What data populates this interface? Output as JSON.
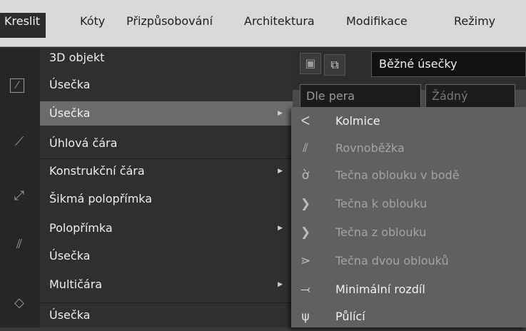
{
  "menubar": {
    "items": [
      "Kreslit",
      "Kóty",
      "Přizpůsobování",
      "Architektura",
      "Modifikace",
      "Režimy"
    ]
  },
  "toolbar": {
    "linetype_value": "Běžné úsečky",
    "pen_value": "Dle pera",
    "fill_value": "Žádný",
    "icons": [
      "3d-object-icon",
      "grid-icon",
      "hatch-icon",
      "snap-icon",
      "copy-icon",
      "layer-icon"
    ]
  },
  "main_menu": {
    "items": [
      {
        "label": "3D objekt",
        "icon": "3d-icon",
        "submenu": false
      },
      {
        "label": "Úsečka",
        "icon": "line-icon",
        "submenu": false
      },
      {
        "label": "Úsečka",
        "icon": "",
        "submenu": true,
        "highlighted": true
      },
      {
        "label": "Úhlová čára",
        "icon": "angle-line-icon",
        "submenu": false
      },
      {
        "label": "Konstrukční čára",
        "icon": "",
        "submenu": true
      },
      {
        "label": "Šikmá polopřímka",
        "icon": "ray-icon",
        "submenu": false
      },
      {
        "label": "Polopřímka",
        "icon": "",
        "submenu": true
      },
      {
        "label": "Úsečka",
        "icon": "parallel-icon",
        "submenu": false
      },
      {
        "label": "Multičára",
        "icon": "",
        "submenu": true
      },
      {
        "label": "Úsečka",
        "icon": "polyline-icon",
        "submenu": false
      }
    ]
  },
  "submenu": {
    "items": [
      {
        "label": "Kolmice",
        "icon": "perpendicular-icon",
        "enabled": true
      },
      {
        "label": "Rovnoběžka",
        "icon": "parallel-line-icon",
        "enabled": false
      },
      {
        "label": "Tečna oblouku v bodě",
        "icon": "tangent-point-icon",
        "enabled": false
      },
      {
        "label": "Tečna k oblouku",
        "icon": "tangent-to-arc-icon",
        "enabled": false
      },
      {
        "label": "Tečna z oblouku",
        "icon": "tangent-from-arc-icon",
        "enabled": false
      },
      {
        "label": "Tečna dvou oblouků",
        "icon": "tangent-two-arcs-icon",
        "enabled": false
      },
      {
        "label": "Minimální rozdíl",
        "icon": "min-distance-icon",
        "enabled": true
      },
      {
        "label": "Půlící",
        "icon": "bisector-icon",
        "enabled": true
      }
    ]
  }
}
